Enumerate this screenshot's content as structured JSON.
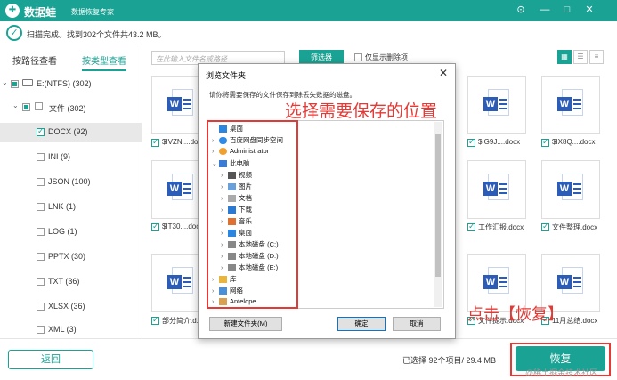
{
  "app": {
    "name": "数据蛙",
    "subtitle": "数据恢复专家",
    "logo_letter": "✚",
    "win_controls": [
      "⊙",
      "—",
      "□",
      "✕"
    ]
  },
  "status": {
    "icon": "✓",
    "text": "扫描完成。找到302个文件共43.2 MB。"
  },
  "sidebar": {
    "tabs": [
      "按路径查看",
      "按类型查看"
    ],
    "active_tab": 1,
    "drive": "E:(NTFS) (302)",
    "folder": "文件 (302)",
    "types": [
      {
        "label": "DOCX (92)",
        "checked": true,
        "selected": true
      },
      {
        "label": "INI (9)",
        "checked": false
      },
      {
        "label": "JSON (100)",
        "checked": false
      },
      {
        "label": "LNK (1)",
        "checked": false
      },
      {
        "label": "LOG (1)",
        "checked": false
      },
      {
        "label": "PPTX (30)",
        "checked": false
      },
      {
        "label": "TXT (36)",
        "checked": false
      },
      {
        "label": "XLSX (36)",
        "checked": false
      },
      {
        "label": "XML (3)",
        "checked": false
      }
    ]
  },
  "toolbar": {
    "search_placeholder": "在此输入文件名或路径",
    "filter_label": "筛选器",
    "deleted_only_label": "仅显示删除项",
    "view_icons": [
      "▦",
      "☰",
      "≡"
    ]
  },
  "files": [
    {
      "name": "$IVZN....docx"
    },
    {
      "name": "$IG9J....docx"
    },
    {
      "name": "$IX8Q....docx"
    },
    {
      "name": "$IT30....docx"
    },
    {
      "name": "工作汇报.docx"
    },
    {
      "name": "文件整理.docx"
    },
    {
      "name": "部分简介.d..."
    },
    {
      "name": "文件提示.docx"
    },
    {
      "name": "11月总结.docx"
    }
  ],
  "bottom": {
    "back_label": "返回",
    "selected_info": "已选择 92个项目/ 29.4 MB",
    "recover_label": "恢复",
    "watermark": "@稀土掘金技术社区"
  },
  "dialog": {
    "title": "浏览文件夹",
    "close": "✕",
    "description": "请你将需要保存的文件保存到除丢失数据的磁盘。",
    "tree": [
      {
        "label": "桌面",
        "icon": "desk",
        "chev": ""
      },
      {
        "label": "百度网盘同步空间",
        "icon": "cloud",
        "chev": "›"
      },
      {
        "label": "Administrator",
        "icon": "user",
        "chev": "›"
      },
      {
        "label": "此电脑",
        "icon": "pc",
        "chev": "⌄"
      },
      {
        "label": "视频",
        "icon": "video",
        "chev": "›"
      },
      {
        "label": "图片",
        "icon": "pic",
        "chev": "›"
      },
      {
        "label": "文档",
        "icon": "docf",
        "chev": "›"
      },
      {
        "label": "下载",
        "icon": "dl",
        "chev": "›"
      },
      {
        "label": "音乐",
        "icon": "music",
        "chev": "›"
      },
      {
        "label": "桌面",
        "icon": "desk",
        "chev": "›"
      },
      {
        "label": "本地磁盘 (C:)",
        "icon": "disk",
        "chev": "›"
      },
      {
        "label": "本地磁盘 (D:)",
        "icon": "disk",
        "chev": "›"
      },
      {
        "label": "本地磁盘 (E:)",
        "icon": "disk",
        "chev": "›"
      },
      {
        "label": "库",
        "icon": "lib",
        "chev": "›"
      },
      {
        "label": "网络",
        "icon": "net",
        "chev": "›"
      },
      {
        "label": "Antelope",
        "icon": "person",
        "chev": "›"
      }
    ],
    "new_folder_label": "新建文件夹(M)",
    "ok_label": "确定",
    "cancel_label": "取消"
  },
  "annotations": {
    "choose_location": "选择需要保存的位置",
    "click_recover": "点击【恢复】"
  },
  "colors": {
    "brand": "#1aa394",
    "annotation": "#e53935",
    "word_blue": "#2b5cb8"
  }
}
